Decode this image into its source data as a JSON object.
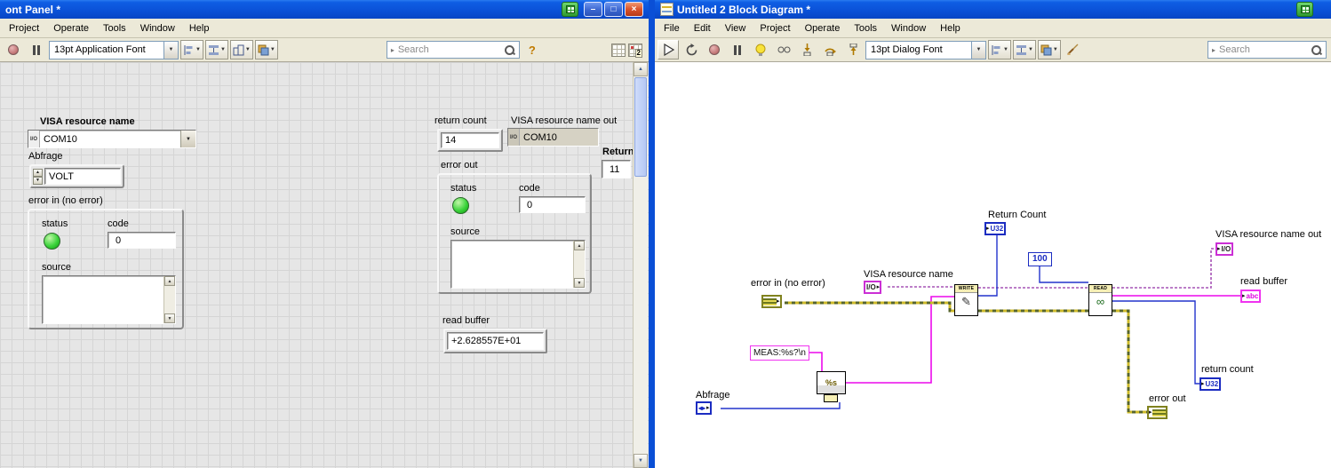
{
  "icons": {
    "chevron_down": "▼",
    "arrow_up": "▲",
    "arrow_down": "▼",
    "arrow_right": "▸",
    "search_chevron": "▸",
    "minimize": "–",
    "maximize": "□",
    "close": "×",
    "help": "?",
    "pencil": "✎",
    "binoculars": "∞",
    "ring_glyph": "◂▸"
  },
  "front_panel_window": {
    "title": "ont Panel *",
    "menu": [
      "Project",
      "Operate",
      "Tools",
      "Window",
      "Help"
    ],
    "toolbar": {
      "font_selector": "13pt Application Font",
      "search_placeholder": "Search",
      "windows_badge": "2"
    },
    "panel": {
      "visa_resource_name": {
        "label": "VISA resource name",
        "value": "COM10",
        "type_glyph": "I/O"
      },
      "abfrage": {
        "label": "Abfrage",
        "value": "VOLT"
      },
      "error_in": {
        "label": "error in (no error)",
        "status_label": "status",
        "code_label": "code",
        "code_value": "0",
        "source_label": "source"
      },
      "return_count": {
        "label": "return count",
        "value": "14"
      },
      "visa_resource_name_out": {
        "label": "VISA resource name out",
        "value": "COM10",
        "type_glyph": "I/O"
      },
      "return_edge": {
        "label": "Return",
        "value": "11"
      },
      "error_out": {
        "label": "error out",
        "status_label": "status",
        "code_label": "code",
        "code_value": "0",
        "source_label": "source"
      },
      "read_buffer": {
        "label": "read buffer",
        "value": "+2.628557E+01"
      }
    }
  },
  "block_diagram_window": {
    "title": "Untitled 2 Block Diagram *",
    "menu": [
      "File",
      "Edit",
      "View",
      "Project",
      "Operate",
      "Tools",
      "Window",
      "Help"
    ],
    "toolbar": {
      "font_selector": "13pt Dialog Font",
      "search_placeholder": "Search"
    },
    "diagram": {
      "error_in_label": "error in (no error)",
      "visa_in_label": "VISA resource name",
      "return_count_top_label": "Return Count",
      "byte_count_value": "100",
      "write_node_label": "WRITE",
      "read_node_label": "READ",
      "visa_out_label": "VISA resource name out",
      "read_buffer_label": "read buffer",
      "return_count_bottom_label": "return count",
      "error_out_label": "error out",
      "format_string_value": "MEAS:%s?\\n",
      "format_node_glyph": "%s",
      "abfrage_label": "Abfrage",
      "u32_glyph": "U32",
      "io_glyph": "I/O",
      "abc_glyph": "abc"
    }
  }
}
